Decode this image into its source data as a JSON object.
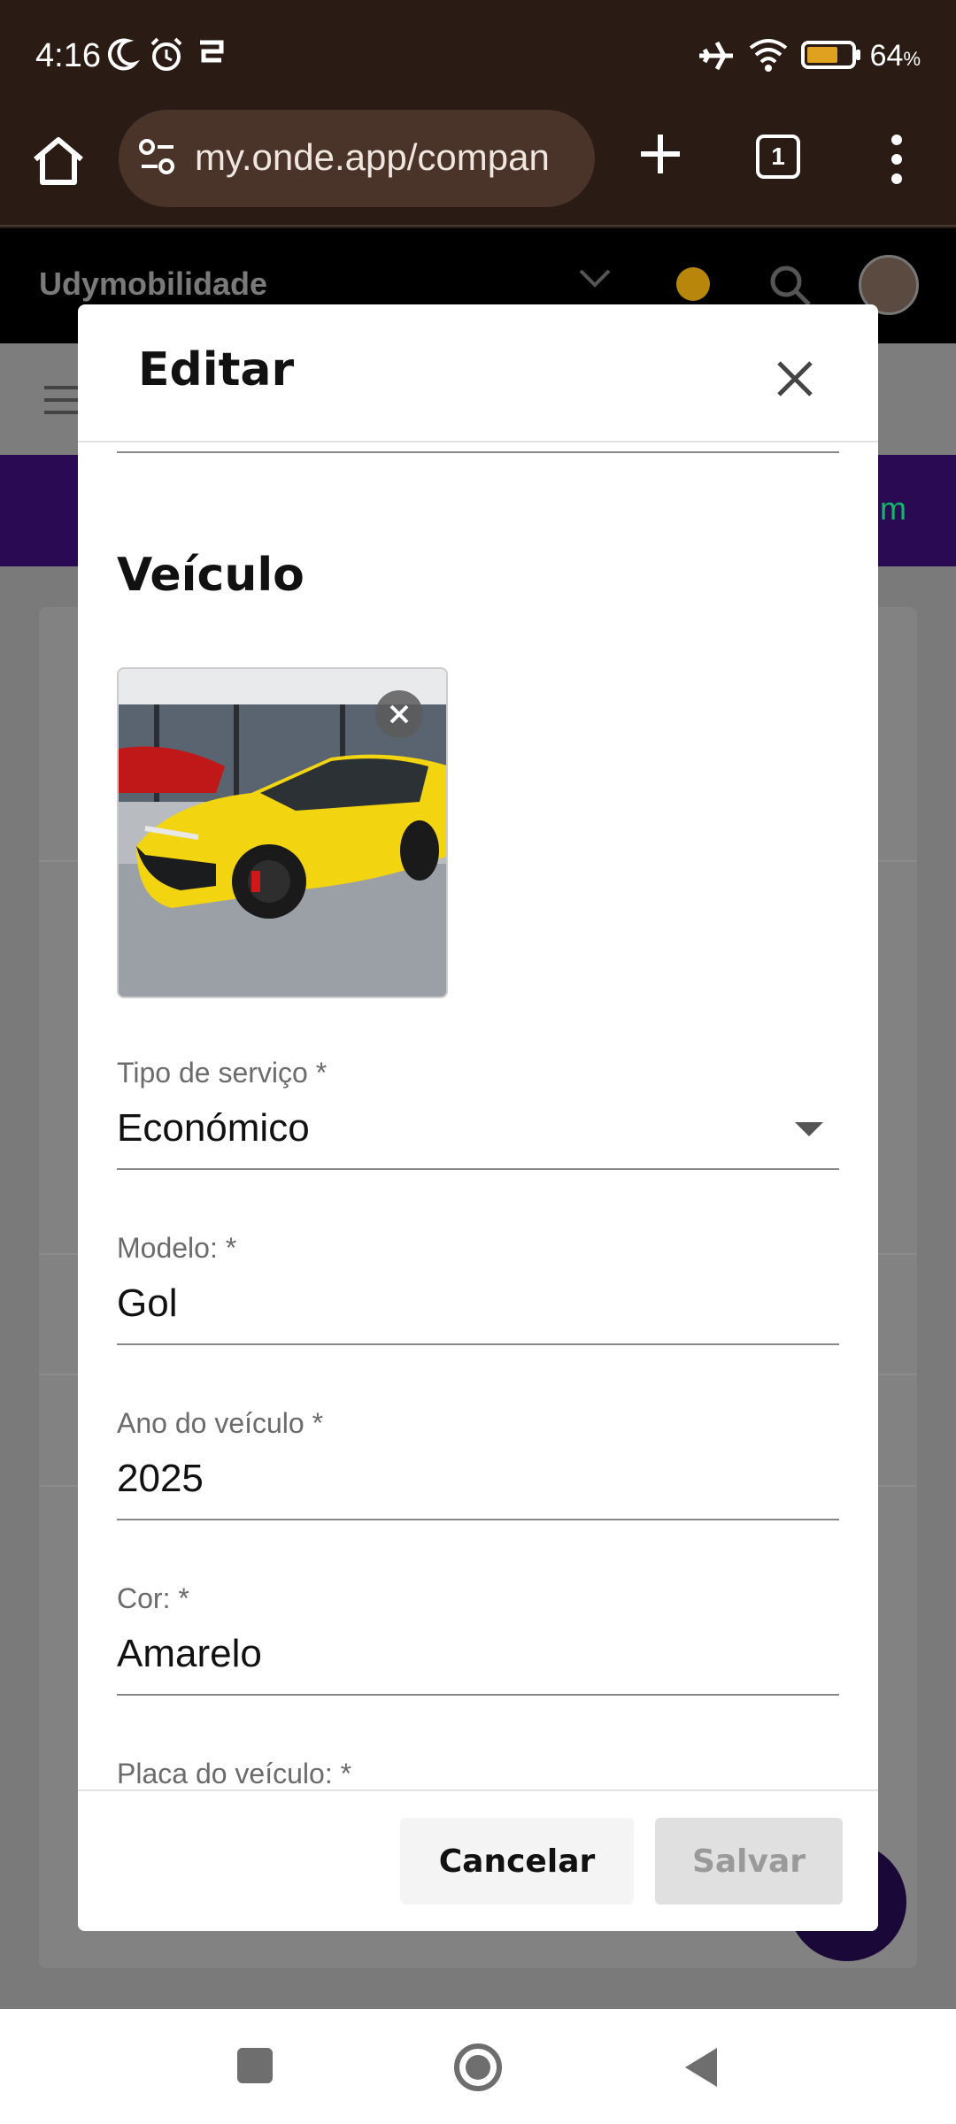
{
  "status_bar": {
    "time": "4:16",
    "battery_pct": "64",
    "battery_pct_suffix": "%",
    "icons": [
      "moon-icon",
      "alarm-icon",
      "cast-icon",
      "airplane-icon",
      "wifi-icon",
      "battery-icon"
    ]
  },
  "browser": {
    "url": "my.onde.app/compan",
    "tab_count": "1"
  },
  "app": {
    "title": "Udymobilidade",
    "banner_peek": "m"
  },
  "dialog": {
    "title": "Editar",
    "section_title": "Veículo",
    "fields": [
      {
        "label": "Tipo de serviço  *",
        "value": "Económico"
      },
      {
        "label": "Modelo:  *",
        "value": "Gol"
      },
      {
        "label": "Ano do veículo  *",
        "value": "2025"
      },
      {
        "label": "Cor:  *",
        "value": "Amarelo"
      },
      {
        "label": "Placa do veículo:  *",
        "value": ""
      }
    ],
    "cancel_label": "Cancelar",
    "save_label": "Salvar"
  },
  "colors": {
    "accent": "#2a0a52",
    "save_disabled": "#e0e0e0"
  }
}
